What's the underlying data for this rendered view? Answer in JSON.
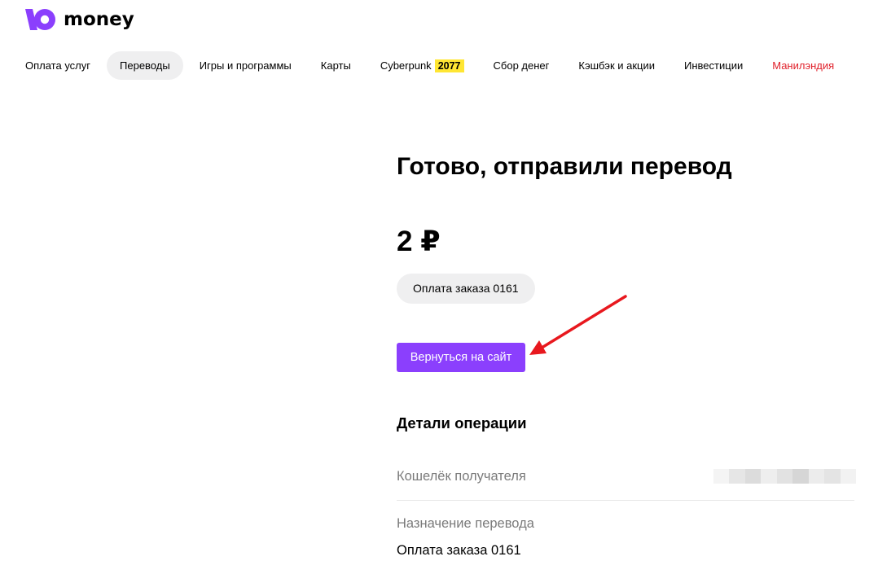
{
  "logo": {
    "text": "money",
    "brand_color": "#8b3ffd"
  },
  "nav": {
    "items": [
      {
        "label": "Оплата услуг"
      },
      {
        "label": "Переводы",
        "active": true
      },
      {
        "label": "Игры и программы"
      },
      {
        "label": "Карты"
      },
      {
        "label": "Cyberpunk",
        "badge": "2077"
      },
      {
        "label": "Сбор денег"
      },
      {
        "label": "Кэшбэк и акции"
      },
      {
        "label": "Инвестиции"
      },
      {
        "label": "Манилэндия",
        "color": "#e0202a"
      }
    ]
  },
  "result": {
    "title": "Готово, отправили перевод",
    "amount": "2 ₽",
    "purpose_chip": "Оплата заказа 0161",
    "back_button": "Вернуться на сайт",
    "button_color": "#8b3ffd"
  },
  "details": {
    "title": "Детали операции",
    "recipient_label": "Кошелёк получателя",
    "purpose_label": "Назначение перевода",
    "purpose_value": "Оплата заказа 0161"
  },
  "annotation": {
    "arrow_color": "#e8181e"
  }
}
